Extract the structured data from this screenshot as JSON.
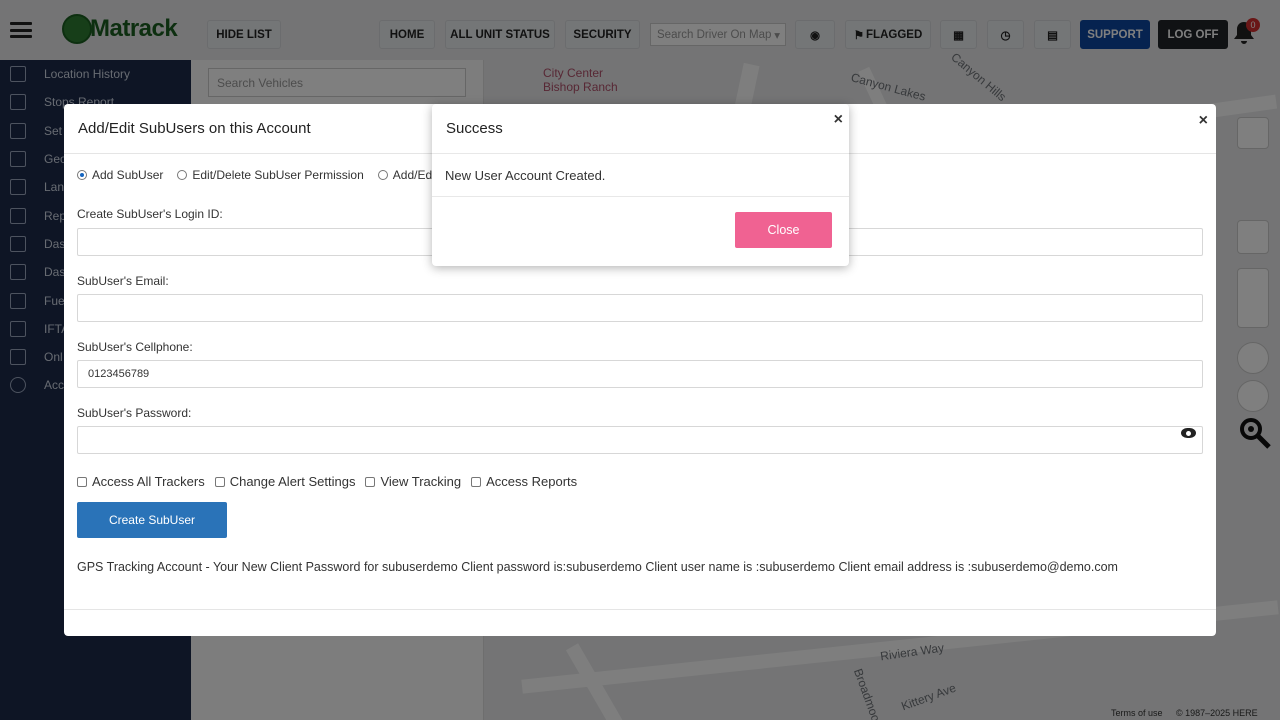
{
  "topbar": {
    "logo_text": "Matrack",
    "hide_list": "HIDE LIST",
    "home": "HOME",
    "all_unit_status": "ALL UNIT STATUS",
    "security": "SECURITY",
    "driver_search_placeholder": "Search Driver On Map",
    "flagged": "FLAGGED",
    "support": "SUPPORT",
    "log_off": "LOG OFF",
    "notification_count": "0"
  },
  "sidebar": {
    "items": [
      {
        "label": "Location History"
      },
      {
        "label": "Stops Report"
      },
      {
        "label": "Set"
      },
      {
        "label": "Geo"
      },
      {
        "label": "Lan"
      },
      {
        "label": "Rep"
      },
      {
        "label": "Das"
      },
      {
        "label": "Das"
      },
      {
        "label": "Fue"
      },
      {
        "label": "IFTA"
      },
      {
        "label": "Onl"
      },
      {
        "label": "Acc"
      }
    ]
  },
  "vehicles": {
    "search_placeholder": "Search Vehicles"
  },
  "map": {
    "labels": [
      "City Center",
      "Bishop Ranch",
      "Canyon Hills",
      "Canyon Lakes",
      "Riviera Way",
      "Kittery Ave",
      "Broadmoor",
      "Bishop"
    ],
    "terms": "Terms of use",
    "copyright": "© 1987–2025 HERE"
  },
  "subuser_modal": {
    "title": "Add/Edit SubUsers on this Account",
    "radios": [
      {
        "label": "Add SubUser",
        "checked": true
      },
      {
        "label": "Edit/Delete SubUser Permission",
        "checked": false
      },
      {
        "label": "Add/Edit T",
        "checked": false
      }
    ],
    "login_label": "Create SubUser's Login ID:",
    "login_value": "",
    "email_label": "SubUser's Email:",
    "email_value": "",
    "phone_label": "SubUser's Cellphone:",
    "phone_value": "0123456789",
    "password_label": "SubUser's Password:",
    "password_value": "",
    "checkboxes": [
      {
        "label": "Access All Trackers"
      },
      {
        "label": "Change Alert Settings"
      },
      {
        "label": "View Tracking"
      },
      {
        "label": "Access Reports"
      }
    ],
    "create_button": "Create SubUser",
    "result_message": "GPS Tracking Account - Your New Client Password for subuserdemo Client password is:subuserdemo Client user name is :subuserdemo Client email address is :subuserdemo@demo.com"
  },
  "success_modal": {
    "title": "Success",
    "message": "New User Account Created.",
    "close_button": "Close",
    "close_x": "×"
  },
  "colors": {
    "sidebar_bg": "#1c2b4a",
    "support_blue": "#0d47a1",
    "create_btn_blue": "#2a73b8",
    "close_btn_pink": "#f06292"
  }
}
